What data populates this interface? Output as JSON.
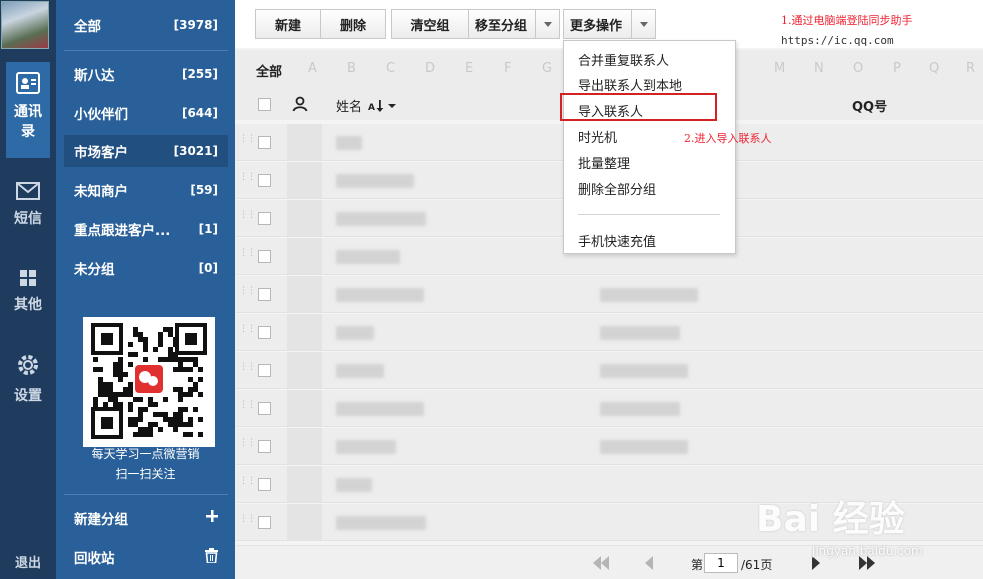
{
  "rail": {
    "contacts_label": "通讯录",
    "sms_label": "短信",
    "other_label": "其他",
    "settings_label": "设置",
    "logout_label": "退出"
  },
  "groups": [
    {
      "name": "全部",
      "count": "[3978]"
    },
    {
      "name": "斯八达",
      "count": "[255]"
    },
    {
      "name": "小伙伴们",
      "count": "[644]"
    },
    {
      "name": "市场客户",
      "count": "[3021]"
    },
    {
      "name": "未知商户",
      "count": "[59]"
    },
    {
      "name": "重点跟进客户...",
      "count": "[1]"
    },
    {
      "name": "未分组",
      "count": "[0]"
    }
  ],
  "promo": {
    "line1": "每天学习一点微营销",
    "line2": "扫一扫关注"
  },
  "sidebar_actions": {
    "new_group": "新建分组",
    "recycle": "回收站"
  },
  "toolbar": {
    "new": "新建",
    "delete": "删除",
    "clear_group": "清空组",
    "move_to_group": "移至分组",
    "more_ops": "更多操作"
  },
  "annotations": {
    "step1": "1.通过电脑端登陆同步助手",
    "url": "https://ic.qq.com",
    "step2": "2.进入导入联系人"
  },
  "alpha": {
    "all": "全部",
    "letters": [
      "A",
      "B",
      "C",
      "D",
      "E",
      "F",
      "G",
      "",
      "",
      "",
      "",
      "",
      "M",
      "N",
      "O",
      "P",
      "Q",
      "R"
    ]
  },
  "columns": {
    "name": "姓名",
    "qq": "QQ号"
  },
  "more_menu": [
    "合并重复联系人",
    "导出联系人到本地",
    "导入联系人",
    "时光机",
    "批量整理",
    "删除全部分组",
    "手机快速充值"
  ],
  "pager": {
    "prefix": "第",
    "current": "1",
    "total": "/61页"
  },
  "watermark": {
    "logo": "Bai 经验",
    "url": "jingyan.baidu.com"
  }
}
